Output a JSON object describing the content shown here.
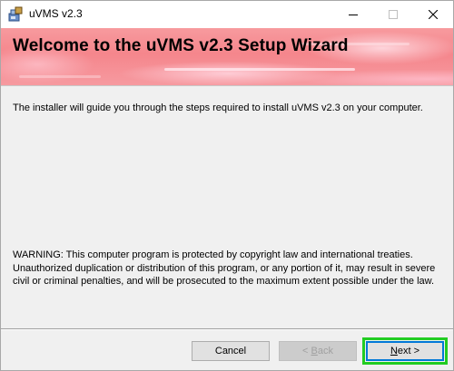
{
  "window": {
    "title": "uVMS v2.3",
    "controls": {
      "minimize": "minimize",
      "maximize": "maximize",
      "close": "close"
    }
  },
  "banner": {
    "title": "Welcome to the uVMS v2.3 Setup Wizard"
  },
  "content": {
    "intro": "The installer will guide you through the steps required to install uVMS v2.3 on your computer.",
    "warning": "WARNING: This computer program is protected by copyright law and international treaties. Unauthorized duplication or distribution of this program, or any portion of it, may result in severe civil or criminal penalties, and will be prosecuted to the maximum extent possible under the law."
  },
  "buttons": {
    "cancel": "Cancel",
    "back_prefix": "< ",
    "back_key": "B",
    "back_rest": "ack",
    "next_key": "N",
    "next_rest": "ext >",
    "back_enabled": false,
    "focused": "next"
  },
  "colors": {
    "banner": "#f5868c",
    "focus": "#22cc22",
    "accent": "#0078d7"
  }
}
